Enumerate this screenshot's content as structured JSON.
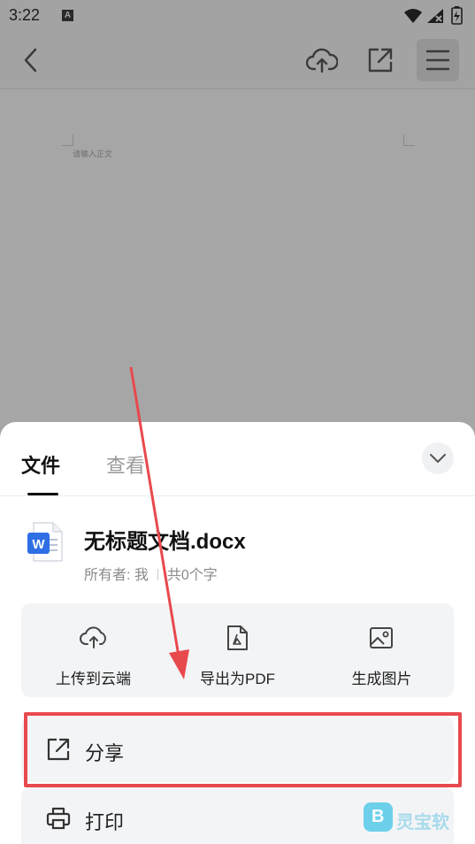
{
  "status_bar": {
    "time": "3:22",
    "notification_badge": "A",
    "icons": [
      "wifi-icon",
      "signal-icon",
      "battery-icon"
    ]
  },
  "toolbar": {
    "icons": [
      "back-icon",
      "cloud-upload-icon",
      "share-external-icon",
      "menu-icon"
    ]
  },
  "document": {
    "placeholder": "请输入正文"
  },
  "sheet": {
    "tabs": [
      {
        "label": "文件",
        "active": true
      },
      {
        "label": "查看",
        "active": false
      }
    ],
    "file": {
      "title": "无标题文档.docx",
      "owner": "所有者: 我",
      "word_count": "共0个字"
    },
    "actions": [
      {
        "label": "上传到云端",
        "icon": "cloud-upload-icon"
      },
      {
        "label": "导出为PDF",
        "icon": "pdf-icon"
      },
      {
        "label": "生成图片",
        "icon": "image-icon"
      }
    ],
    "menu": [
      {
        "label": "分享",
        "icon": "share-icon"
      },
      {
        "label": "打印",
        "icon": "print-icon"
      }
    ]
  },
  "annotation": {
    "highlight_color": "#e8494d"
  },
  "watermark": {
    "text": "灵宝软"
  },
  "colors": {
    "overlay": "#a6a6a6",
    "sheet_bg": "#ffffff",
    "card_bg": "#f3f4f6",
    "word_blue": "#2f6fe5",
    "annotation_red": "#e8494d"
  }
}
